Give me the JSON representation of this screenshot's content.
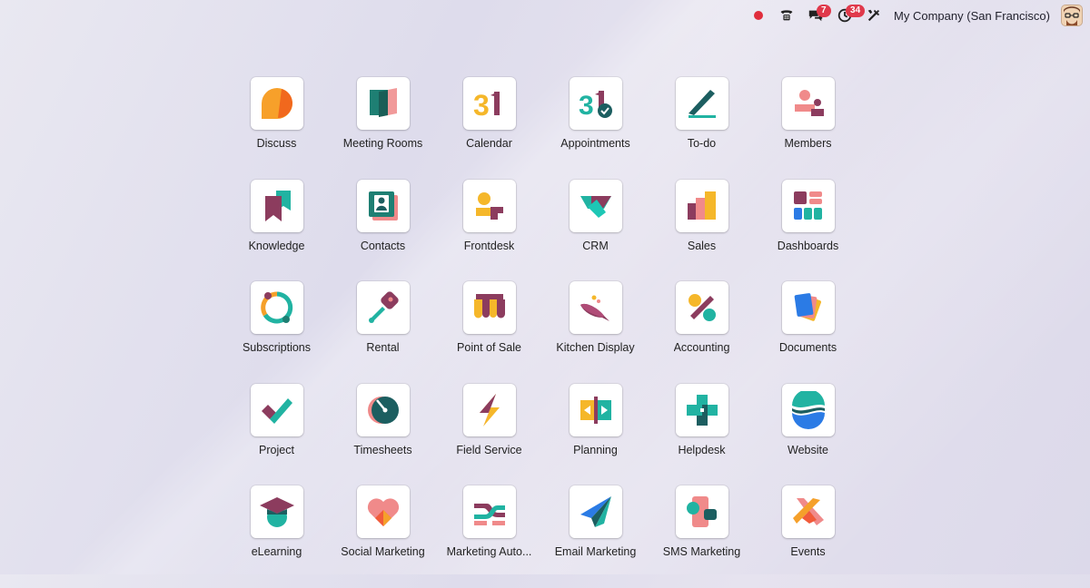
{
  "topbar": {
    "messages_badge": "7",
    "activities_badge": "34",
    "company": "My Company (San Francisco)"
  },
  "apps": [
    {
      "label": "Discuss",
      "icon": "discuss-icon"
    },
    {
      "label": "Meeting Rooms",
      "icon": "meeting-rooms-icon"
    },
    {
      "label": "Calendar",
      "icon": "calendar-icon"
    },
    {
      "label": "Appointments",
      "icon": "appointments-icon"
    },
    {
      "label": "To-do",
      "icon": "todo-icon"
    },
    {
      "label": "Members",
      "icon": "members-icon"
    },
    {
      "label": "Knowledge",
      "icon": "knowledge-icon"
    },
    {
      "label": "Contacts",
      "icon": "contacts-icon"
    },
    {
      "label": "Frontdesk",
      "icon": "frontdesk-icon"
    },
    {
      "label": "CRM",
      "icon": "crm-icon"
    },
    {
      "label": "Sales",
      "icon": "sales-icon"
    },
    {
      "label": "Dashboards",
      "icon": "dashboards-icon"
    },
    {
      "label": "Subscriptions",
      "icon": "subscriptions-icon"
    },
    {
      "label": "Rental",
      "icon": "rental-icon"
    },
    {
      "label": "Point of Sale",
      "icon": "point-of-sale-icon"
    },
    {
      "label": "Kitchen Display",
      "icon": "kitchen-display-icon"
    },
    {
      "label": "Accounting",
      "icon": "accounting-icon"
    },
    {
      "label": "Documents",
      "icon": "documents-icon"
    },
    {
      "label": "Project",
      "icon": "project-icon"
    },
    {
      "label": "Timesheets",
      "icon": "timesheets-icon"
    },
    {
      "label": "Field Service",
      "icon": "field-service-icon"
    },
    {
      "label": "Planning",
      "icon": "planning-icon"
    },
    {
      "label": "Helpdesk",
      "icon": "helpdesk-icon"
    },
    {
      "label": "Website",
      "icon": "website-icon"
    },
    {
      "label": "eLearning",
      "icon": "elearning-icon"
    },
    {
      "label": "Social Marketing",
      "icon": "social-marketing-icon"
    },
    {
      "label": "Marketing Auto...",
      "icon": "marketing-automation-icon"
    },
    {
      "label": "Email Marketing",
      "icon": "email-marketing-icon"
    },
    {
      "label": "SMS Marketing",
      "icon": "sms-marketing-icon"
    },
    {
      "label": "Events",
      "icon": "events-icon"
    }
  ]
}
